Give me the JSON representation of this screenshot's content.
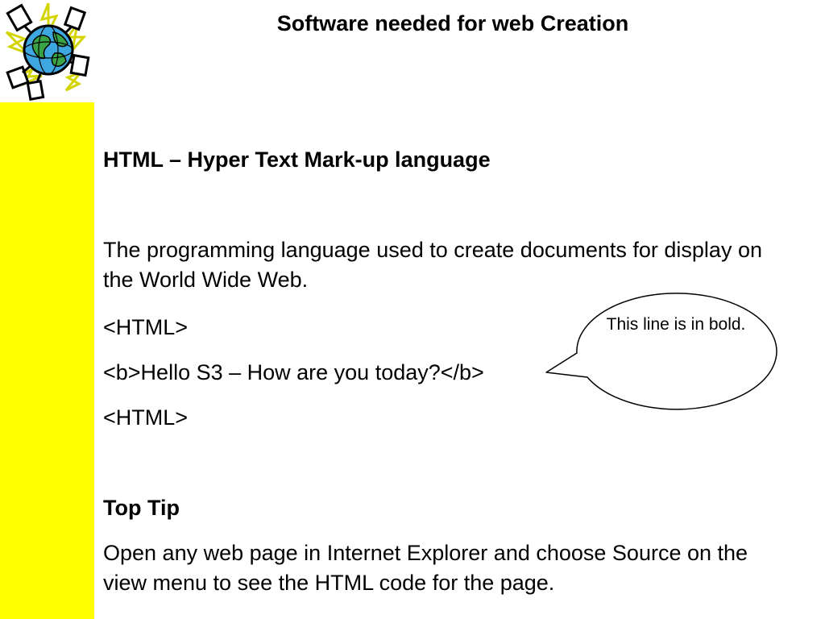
{
  "slide": {
    "title": "Software needed for web Creation",
    "heading_html": "HTML – Hyper Text Mark-up language",
    "description": "The programming language used to create documents for display on the World Wide Web.",
    "code_lines": [
      "<HTML>",
      "<b>Hello S3 – How are you today?</b>",
      "<HTML>"
    ],
    "callout": "This line is in bold.",
    "tip_heading": "Top Tip",
    "tip_text": "Open any web page in Internet Explorer and choose Source on the view menu to see the HTML code for the page."
  },
  "theme": {
    "sidebar_color": "#ffff00",
    "logo_icon": "globe-icon"
  }
}
